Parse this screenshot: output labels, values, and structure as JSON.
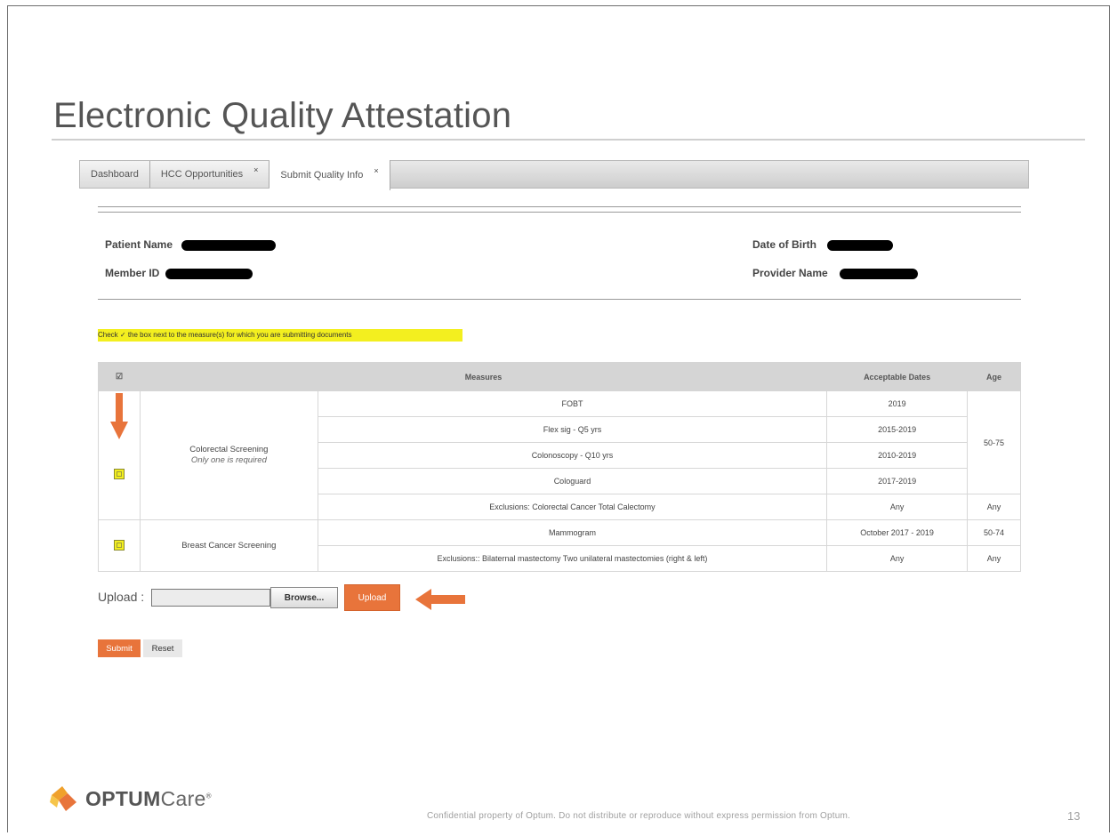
{
  "slide": {
    "title": "Electronic Quality Attestation",
    "page_number": "13",
    "footer": "Confidential  property of Optum.  Do not distribute or reproduce  without  express permission from Optum."
  },
  "logo": {
    "brand": "OPTUM",
    "product": "Care",
    "mark": "®"
  },
  "tabs": [
    {
      "label": "Dashboard",
      "closable": false,
      "active": false
    },
    {
      "label": "HCC Opportunities",
      "closable": true,
      "active": false
    },
    {
      "label": "Submit Quality Info",
      "closable": true,
      "active": true
    }
  ],
  "tab_close_glyph": "×",
  "patient": {
    "name_label": "Patient Name",
    "member_id_label": "Member ID",
    "dob_label": "Date of Birth",
    "provider_label": "Provider Name"
  },
  "instruction": "Check ✓ the box next to the measure(s) for which you are submitting documents",
  "table": {
    "headers": {
      "check": "☑",
      "measures": "Measures",
      "dates": "Acceptable Dates",
      "age": "Age"
    },
    "colorectal": {
      "group": "Colorectal Screening",
      "note": "Only one is required",
      "rows": [
        {
          "measure": "FOBT",
          "dates": "2019"
        },
        {
          "measure": "Flex sig - Q5 yrs",
          "dates": "2015-2019"
        },
        {
          "measure": "Colonoscopy - Q10 yrs",
          "dates": "2010-2019"
        },
        {
          "measure": "Cologuard",
          "dates": "2017-2019"
        }
      ],
      "age": "50-75",
      "exclusion": {
        "measure": "Exclusions: Colorectal Cancer Total Calectomy",
        "dates": "Any",
        "age": "Any"
      }
    },
    "breast": {
      "group": "Breast Cancer Screening",
      "row": {
        "measure": "Mammogram",
        "dates": "October 2017 - 2019",
        "age": "50-74"
      },
      "exclusion": {
        "measure": "Exclusions:: Bilaternal mastectomy Two unilateral mastectomies (right & left)",
        "dates": "Any",
        "age": "Any"
      }
    }
  },
  "upload": {
    "label": "Upload :",
    "browse": "Browse...",
    "button": "Upload"
  },
  "actions": {
    "submit": "Submit",
    "reset": "Reset"
  },
  "colors": {
    "accent": "#e8743b",
    "highlight": "#f3ef1f"
  }
}
